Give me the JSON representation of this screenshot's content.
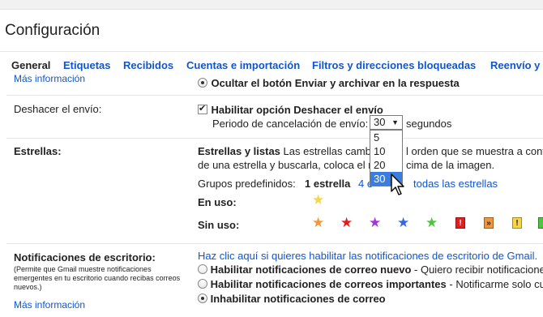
{
  "page": {
    "title": "Configuración"
  },
  "tabs": [
    {
      "label": "General"
    },
    {
      "label": "Etiquetas"
    },
    {
      "label": "Recibidos"
    },
    {
      "label": "Cuentas e importación"
    },
    {
      "label": "Filtros y direcciones bloqueadas"
    },
    {
      "label": "Reenvío y c"
    }
  ],
  "top_row": {
    "more_info": "Más información",
    "radio_label": "Ocultar el botón Enviar y archivar en la respuesta"
  },
  "undo_send": {
    "label": "Deshacer el envío:",
    "checkbox_label": "Habilitar opción Deshacer el envío",
    "period_label": "Periodo de cancelación de envío:",
    "selected_value": "30",
    "unit": "segundos",
    "options": [
      "5",
      "10",
      "20",
      "30"
    ]
  },
  "stars": {
    "label": "Estrellas:",
    "desc_bold": "Estrellas y listas",
    "desc_line1": " Las estrellas camb",
    "desc_line1_tail": "l orden que se muestra a cont",
    "desc_line2": "de una estrella y buscarla, coloca el r",
    "desc_line2_tail": "cima de la imagen.",
    "presets_label": "Grupos predefinidos:",
    "preset_1": "1 estrella",
    "preset_4": "4 e",
    "preset_all": "todas las estrellas",
    "in_use": "En uso:",
    "not_in_use": "Sin uso:",
    "in_use_icons": [
      "yellow-star"
    ],
    "not_in_use_icons": [
      "orange-star",
      "red-star",
      "purple-star",
      "blue-star",
      "green-star",
      "red-bang",
      "orange-guillemet",
      "yellow-bang",
      "green-check"
    ],
    "colors": {
      "yellow": "#f7d44c",
      "orange": "#f2963c",
      "red": "#e02020",
      "purple": "#a533d9",
      "blue": "#3469e0",
      "green": "#4fc43f"
    },
    "square_glyphs": {
      "red_bang": "!",
      "orange_guillemet": "»",
      "yellow_bang": "!"
    }
  },
  "notifications": {
    "label": "Notificaciones de escritorio:",
    "note": "(Permite que Gmail muestre notificaciones emergentes en tu escritorio cuando recibas correos nuevos.)",
    "more_info": "Más información",
    "enable_link": "Haz clic aquí si quieres habilitar las notificaciones de escritorio de Gmail.",
    "opt1_bold": "Habilitar notificaciones de correo nuevo",
    "opt1_rest": " - Quiero recibir notificacione",
    "opt2_bold": "Habilitar notificaciones de correos importantes",
    "opt2_rest": " - Notificarme solo cu",
    "opt3_bold": "Inhabilitar notificaciones de correo"
  }
}
